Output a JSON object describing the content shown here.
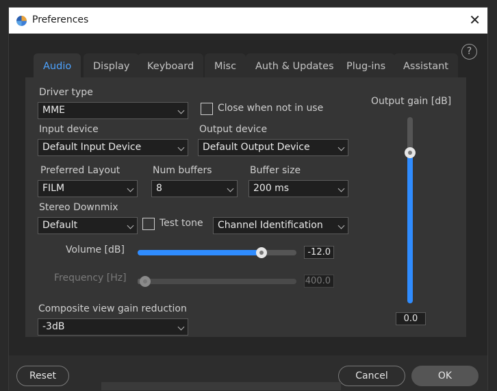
{
  "window": {
    "title": "Preferences",
    "close_glyph": "✕"
  },
  "help": {
    "glyph": "?"
  },
  "tabs": [
    {
      "label": "Audio",
      "active": true
    },
    {
      "label": "Display"
    },
    {
      "label": "Keyboard"
    },
    {
      "label": "Misc"
    },
    {
      "label": "Auth & Updates"
    },
    {
      "label": "Plug-ins"
    },
    {
      "label": "Assistant"
    }
  ],
  "audio": {
    "driver_type": {
      "label": "Driver type",
      "value": "MME"
    },
    "close_when_not_in_use": {
      "label": "Close when not in use",
      "checked": false
    },
    "input_device": {
      "label": "Input device",
      "value": "Default Input Device"
    },
    "output_device": {
      "label": "Output device",
      "value": "Default Output Device"
    },
    "preferred_layout": {
      "label": "Preferred Layout",
      "value": "FILM"
    },
    "num_buffers": {
      "label": "Num buffers",
      "value": "8"
    },
    "buffer_size": {
      "label": "Buffer size",
      "value": "200 ms"
    },
    "stereo_downmix": {
      "label": "Stereo Downmix",
      "value": "Default"
    },
    "test_tone": {
      "label": "Test tone",
      "checked": false
    },
    "test_tone_signal": {
      "value": "Channel Identification"
    },
    "volume": {
      "label": "Volume [dB]",
      "value": "-12.0",
      "level": 0.78
    },
    "frequency": {
      "label": "Frequency [Hz]",
      "value": "400.0",
      "level": 0.02,
      "disabled": true
    },
    "composite_gain": {
      "label": "Composite view gain reduction",
      "value": "-3dB"
    },
    "output_gain": {
      "label": "Output gain [dB]",
      "value": "0.0",
      "level": 0.81
    }
  },
  "footer": {
    "reset_label": "Reset",
    "cancel_label": "Cancel",
    "ok_label": "OK"
  }
}
